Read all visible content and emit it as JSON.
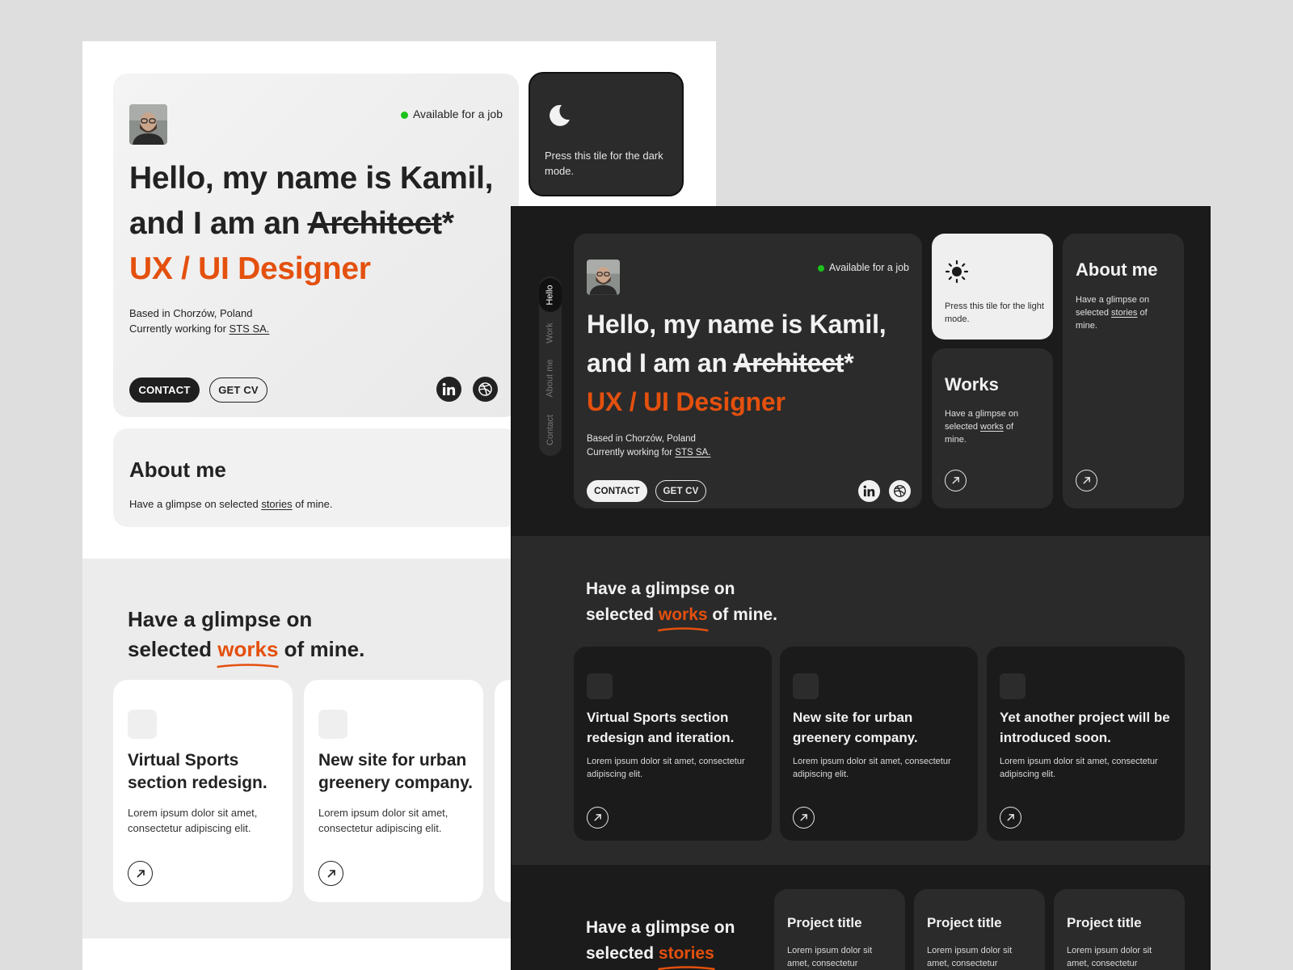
{
  "light": {
    "status": "Available for a job",
    "hero_line1": "Hello, my name is Kamil,",
    "hero_line2_prefix": "and I am an ",
    "hero_strike": "Architect",
    "hero_asterisk": "*",
    "hero_role": "UX / UI Designer",
    "based": "Based in Chorzów, Poland",
    "working_prefix": "Currently working for ",
    "working_company": "STS SA.",
    "contact_label": "CONTACT",
    "getcv_label": "GET CV",
    "dark_tile_text": "Press this tile for the dark mode.",
    "about_title": "About me",
    "about_prefix": "Have a glimpse on selected ",
    "about_link": "stories",
    "about_suffix": " of mine.",
    "works_heading_line1": "Have a glimpse on",
    "works_heading_prefix": "selected ",
    "works_heading_word": "works",
    "works_heading_suffix": " of mine.",
    "cards": [
      {
        "title": "Virtual Sports section redesign.",
        "desc": "Lorem ipsum dolor sit amet, consectetur adipiscing elit."
      },
      {
        "title": "New site for urban greenery company.",
        "desc": "Lorem ipsum dolor sit amet, consectetur adipiscing elit."
      }
    ]
  },
  "dark": {
    "nav": [
      "Hello",
      "Work",
      "About me",
      "Contact"
    ],
    "status": "Available for a job",
    "hero_line1": "Hello, my name is Kamil,",
    "hero_line2_prefix": "and I am an ",
    "hero_strike": "Architect",
    "hero_asterisk": "*",
    "hero_role": "UX / UI Designer",
    "based": "Based in Chorzów, Poland",
    "working_prefix": "Currently working for ",
    "working_company": "STS SA.",
    "contact_label": "CONTACT",
    "getcv_label": "GET CV",
    "light_tile_text": "Press this tile for the light mode.",
    "about_title": "About me",
    "about_prefix": "Have a glimpse on selected ",
    "about_link": "stories",
    "about_suffix": " of mine.",
    "works_title": "Works",
    "works_prefix": "Have a glimpse on selected ",
    "works_link": "works",
    "works_suffix": " of mine.",
    "works_heading_line1": "Have a glimpse on",
    "works_heading_prefix": "selected ",
    "works_heading_word": "works",
    "works_heading_suffix": " of mine.",
    "cards": [
      {
        "title": "Virtual Sports section redesign and iteration.",
        "desc": "Lorem ipsum dolor sit amet, consectetur adipiscing elit."
      },
      {
        "title": "New site for urban greenery company.",
        "desc": "Lorem ipsum dolor sit amet, consectetur adipiscing elit."
      },
      {
        "title": "Yet another project will be introduced soon.",
        "desc": "Lorem ipsum dolor sit amet, consectetur adipiscing elit."
      }
    ],
    "stories_heading_line1": "Have a glimpse on",
    "stories_heading_prefix": "selected ",
    "stories_heading_word": "stories",
    "projects": [
      {
        "title": "Project title",
        "desc": "Lorem ipsum dolor sit amet, consectetur"
      },
      {
        "title": "Project title",
        "desc": "Lorem ipsum dolor sit amet, consectetur"
      },
      {
        "title": "Project title",
        "desc": "Lorem ipsum dolor sit amet, consectetur"
      }
    ]
  },
  "colors": {
    "accent": "#e4500e",
    "status_dot": "#1bc21b",
    "dark_bg": "#1b1b1b",
    "dark_tile": "#2b2b2b"
  },
  "icons": [
    "avatar",
    "moon-icon",
    "sun-icon",
    "linkedin-icon",
    "dribbble-icon",
    "arrow-up-right-icon"
  ]
}
